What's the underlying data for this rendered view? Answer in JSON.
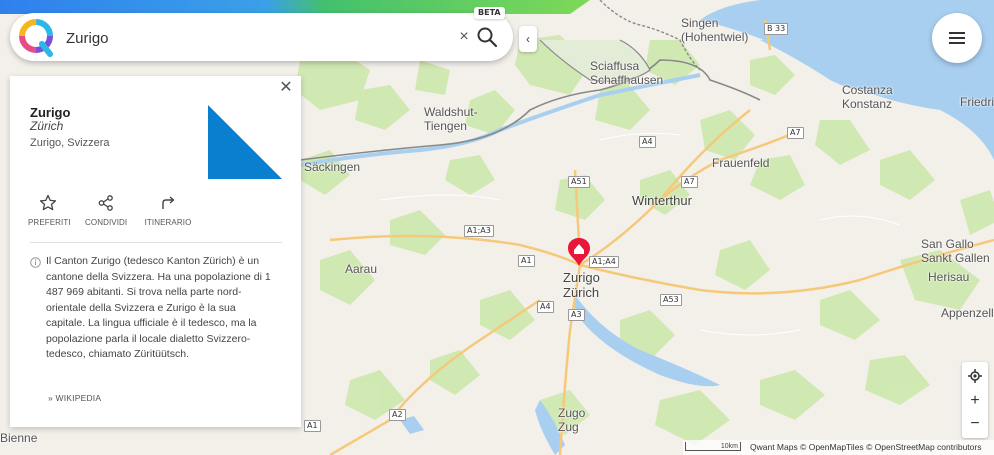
{
  "search": {
    "query": "Zurigo",
    "beta_label": "BETA"
  },
  "panel": {
    "title": "Zurigo",
    "subtitle": "Zürich",
    "location": "Zurigo, Svizzera",
    "actions": [
      {
        "label": "PREFERITI",
        "icon": "star-icon"
      },
      {
        "label": "CONDIVIDI",
        "icon": "share-icon"
      },
      {
        "label": "ITINERARIO",
        "icon": "directions-icon"
      }
    ],
    "description": "Il Canton Zurigo (tedesco Kanton Zürich) è un cantone della Svizzera. Ha una popolazione di 1 487 969 abitanti. Si trova nella parte nord-orientale della Svizzera e Zurigo è la sua capitale. La lingua ufficiale è il tedesco, ma la popolazione parla il locale dialetto Svizzero-tedesco, chiamato Züritüütsch.",
    "wiki_link": "» WIKIPEDIA"
  },
  "map": {
    "places": {
      "singen": "Singen\n(Hohentwiel)",
      "sciaffusa": "Sciaffusa\nSchaffhausen",
      "waldshut": "Waldshut-\nTiengen",
      "costanza": "Costanza\nKonstanz",
      "friedrichshafen": "Friedric",
      "sackingen": "Säckingen",
      "frauenfeld": "Frauenfeld",
      "winterthur": "Winterthur",
      "aarau": "Aarau",
      "zurigo": "Zurigo\nZürich",
      "sangallo": "San Gallo\nSankt Gallen",
      "herisau": "Herisau",
      "appenzell": "Appenzell",
      "zugo": "Zugo\nZug",
      "bienne": "Bienne"
    },
    "roads": {
      "b33": "B 33",
      "a4_1": "A4",
      "a7_1": "A7",
      "a7_2": "A7",
      "a51": "A51",
      "a1a3": "A1;A3",
      "a1a4": "A1;A4",
      "a1": "A1",
      "a53": "A53",
      "a4_2": "A4",
      "a3": "A3",
      "a2": "A2",
      "a1_2": "A1"
    },
    "zoom_in": "+",
    "zoom_out": "−",
    "scale": "10km",
    "attribution": {
      "qwant": "Qwant Maps",
      "omt": "© OpenMapTiles",
      "osm": "© OpenStreetMap contributors"
    }
  },
  "colors": {
    "brand_top": "#2f80ed",
    "water": "#a9cff0",
    "forest": "#cfe8b0",
    "marker": "#e8163a",
    "image_triangle": "#0a7fd0"
  }
}
